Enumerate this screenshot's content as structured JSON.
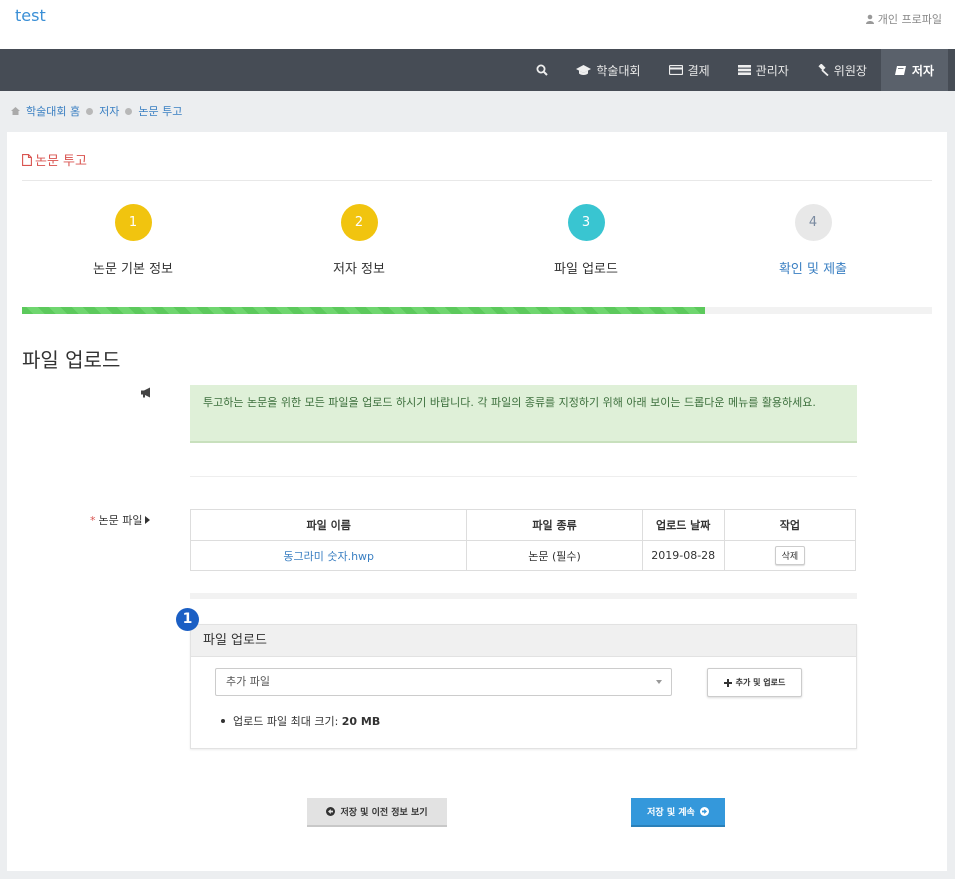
{
  "app": {
    "brand": "test",
    "profile_label": "개인 프로파일"
  },
  "nav": {
    "items": [
      {
        "label": "",
        "icon": "search-icon"
      },
      {
        "label": "학술대회",
        "icon": "graduation-cap-icon"
      },
      {
        "label": "결제",
        "icon": "credit-card-icon"
      },
      {
        "label": "관리자",
        "icon": "server-icon"
      },
      {
        "label": "위원장",
        "icon": "gavel-icon"
      },
      {
        "label": "저자",
        "icon": "book-icon",
        "active": true
      }
    ]
  },
  "breadcrumb": {
    "items": [
      "학술대회 홈",
      "저자",
      "논문 투고"
    ]
  },
  "page": {
    "header": "논문 투고",
    "section_title": "파일 업로드"
  },
  "steps": [
    {
      "number": "1",
      "label": "논문 기본 정보",
      "state": "done"
    },
    {
      "number": "2",
      "label": "저자 정보",
      "state": "done"
    },
    {
      "number": "3",
      "label": "파일 업로드",
      "state": "current"
    },
    {
      "number": "4",
      "label": "확인 및 제출",
      "state": "todo"
    }
  ],
  "progress": {
    "percent": 75
  },
  "alert": {
    "text": "투고하는 논문을 위한 모든 파일을 업로드 하시기 바랍니다. 각 파일의 종류를 지정하기 위해 아래 보이는 드롭다운 메뉴를 활용하세요."
  },
  "files": {
    "label": "논문 파일",
    "required_mark": "*",
    "headers": [
      "파일 이름",
      "파일 종류",
      "업로드 날짜",
      "작업"
    ],
    "rows": [
      {
        "name": "동그라미 숫자.hwp",
        "type": "논문 (필수)",
        "date": "2019-08-28",
        "action": "삭제"
      }
    ]
  },
  "upload": {
    "badge": "1",
    "title": "파일 업로드",
    "select_value": "추가 파일",
    "add_button": "추가 및 업로드",
    "max_size_label": "업로드 파일 최대 크기:",
    "max_size_value": "20 MB"
  },
  "buttons": {
    "prev": "저장 및 이전 정보 보기",
    "next": "저장 및 계속"
  },
  "colors": {
    "brand": "#3a8fd6",
    "navbar": "#464c55",
    "step_done": "#f1c40f",
    "step_current": "#39c5d1",
    "progress": "#5cc95c",
    "primary": "#3498db",
    "danger": "#d9534f"
  }
}
